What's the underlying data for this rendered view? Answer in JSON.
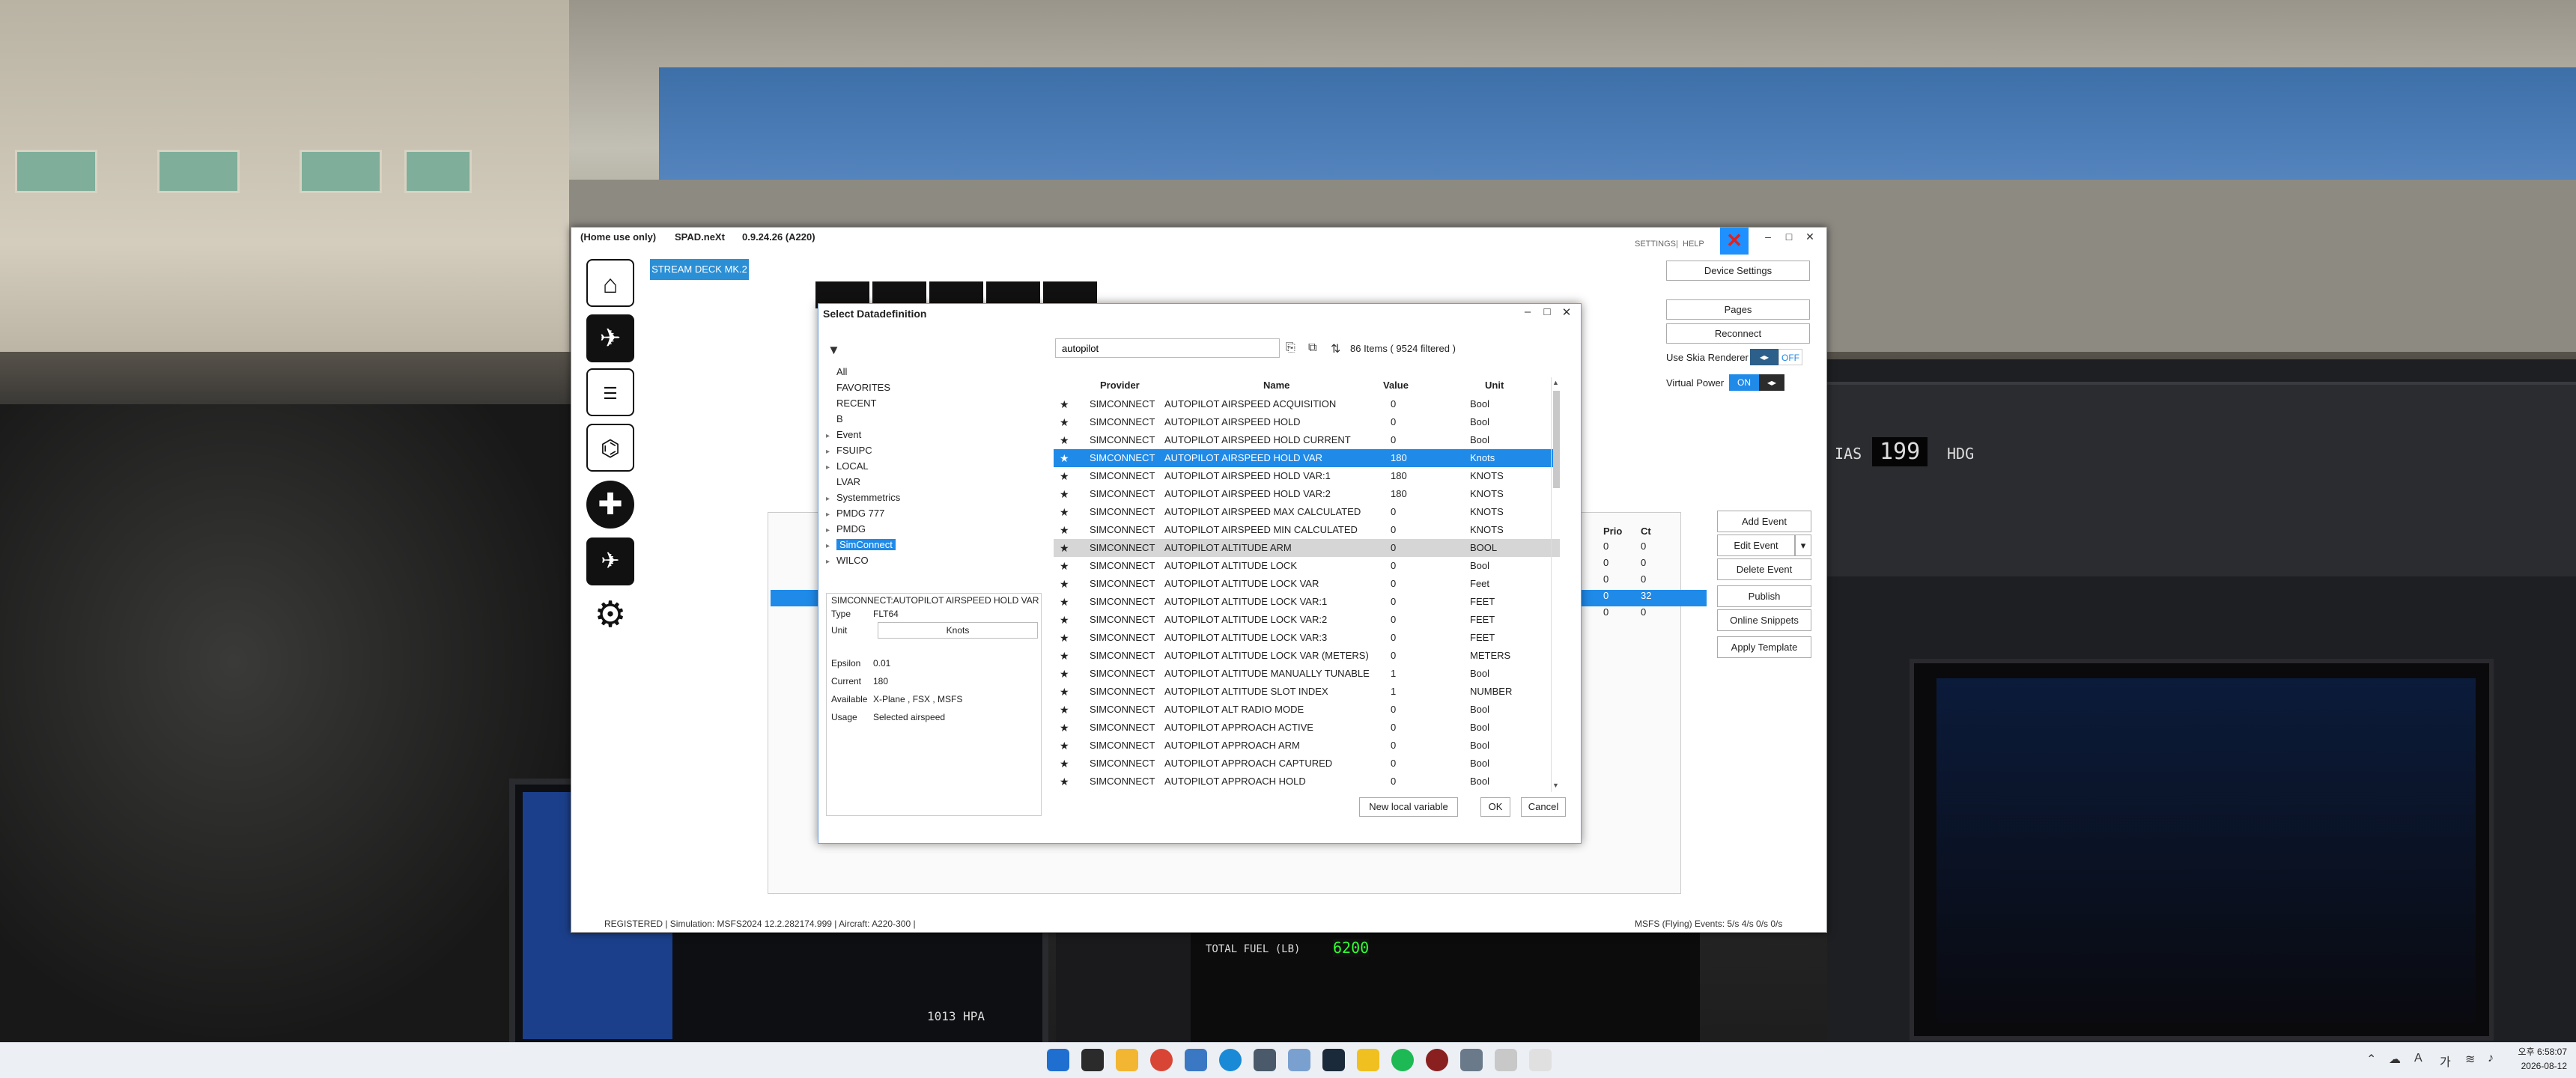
{
  "window": {
    "license": "(Home use only)",
    "app_name": "SPAD.neXt",
    "version": "0.9.24.26 (A220)",
    "settings_label": "SETTINGS",
    "help_label": "HELP",
    "separator": "|",
    "device_tab": "STREAM DECK MK.2"
  },
  "nav_icons": [
    "home-icon",
    "airplane-panel-icon",
    "radio-stack-icon",
    "cockpit-controls-icon",
    "medical-cross-icon",
    "camera-plane-icon",
    "settings-gears-icon"
  ],
  "right_panel": {
    "device_settings": "Device Settings",
    "pages": "Pages",
    "reconnect": "Reconnect",
    "skia_label": "Use Skia Renderer",
    "skia_toggle": "OFF",
    "power_label": "Virtual Power",
    "power_toggle": "ON",
    "toggle_knob": "◂▸"
  },
  "side_buttons": {
    "add_event": "Add Event",
    "edit_event": "Edit Event",
    "delete_event": "Delete Event",
    "publish": "Publish",
    "online_snippets": "Online Snippets",
    "apply_template": "Apply Template"
  },
  "background_table": {
    "prio_header": "Prio",
    "ct_header": "Ct",
    "rows": [
      {
        "prio": "0",
        "ct": "0"
      },
      {
        "prio": "0",
        "ct": "0"
      },
      {
        "prio": "0",
        "ct": "0"
      },
      {
        "prio": "0",
        "ct": "32"
      },
      {
        "prio": "0",
        "ct": "0"
      }
    ]
  },
  "status_bar": {
    "left": "REGISTERED  | Simulation: MSFS2024 12.2.282174.999  | Aircraft: A220-300  |",
    "right": "MSFS (Flying)  Events: 5/s 4/s 0/s 0/s"
  },
  "dialog": {
    "title": "Select Datadefinition",
    "search_value": "autopilot",
    "count_text": "86 Items ( 9524 filtered )",
    "tree": [
      {
        "label": "All",
        "arrow": false
      },
      {
        "label": "FAVORITES",
        "arrow": false
      },
      {
        "label": "RECENT",
        "arrow": false
      },
      {
        "label": "B",
        "arrow": false
      },
      {
        "label": "Event",
        "arrow": true
      },
      {
        "label": "FSUIPC",
        "arrow": true
      },
      {
        "label": "LOCAL",
        "arrow": true
      },
      {
        "label": "LVAR",
        "arrow": false
      },
      {
        "label": "Systemmetrics",
        "arrow": true
      },
      {
        "label": "PMDG 777",
        "arrow": true
      },
      {
        "label": "PMDG",
        "arrow": true
      },
      {
        "label": "SimConnect",
        "arrow": true,
        "selected": true
      },
      {
        "label": "WILCO",
        "arrow": true
      }
    ],
    "info": {
      "title": "SIMCONNECT:AUTOPILOT AIRSPEED HOLD VAR",
      "type_label": "Type",
      "type_value": "FLT64",
      "unit_label": "Unit",
      "unit_value": "Knots",
      "epsilon_label": "Epsilon",
      "epsilon_value": "0.01",
      "current_label": "Current",
      "current_value": "180",
      "available_label": "Available",
      "available_value": "X-Plane , FSX , MSFS",
      "usage_label": "Usage",
      "usage_value": "Selected airspeed"
    },
    "columns": {
      "provider": "Provider",
      "name": "Name",
      "value": "Value",
      "unit": "Unit"
    },
    "rows": [
      {
        "provider": "SIMCONNECT",
        "name": "AUTOPILOT AIRSPEED ACQUISITION",
        "value": "0",
        "unit": "Bool"
      },
      {
        "provider": "SIMCONNECT",
        "name": "AUTOPILOT AIRSPEED HOLD",
        "value": "0",
        "unit": "Bool"
      },
      {
        "provider": "SIMCONNECT",
        "name": "AUTOPILOT AIRSPEED HOLD CURRENT",
        "value": "0",
        "unit": "Bool"
      },
      {
        "provider": "SIMCONNECT",
        "name": "AUTOPILOT AIRSPEED HOLD VAR",
        "value": "180",
        "unit": "Knots",
        "state": "selected"
      },
      {
        "provider": "SIMCONNECT",
        "name": "AUTOPILOT AIRSPEED HOLD VAR:1",
        "value": "180",
        "unit": "KNOTS"
      },
      {
        "provider": "SIMCONNECT",
        "name": "AUTOPILOT AIRSPEED HOLD VAR:2",
        "value": "180",
        "unit": "KNOTS"
      },
      {
        "provider": "SIMCONNECT",
        "name": "AUTOPILOT AIRSPEED MAX CALCULATED",
        "value": "0",
        "unit": "KNOTS"
      },
      {
        "provider": "SIMCONNECT",
        "name": "AUTOPILOT AIRSPEED MIN CALCULATED",
        "value": "0",
        "unit": "KNOTS"
      },
      {
        "provider": "SIMCONNECT",
        "name": "AUTOPILOT ALTITUDE ARM",
        "value": "0",
        "unit": "BOOL",
        "state": "hover"
      },
      {
        "provider": "SIMCONNECT",
        "name": "AUTOPILOT ALTITUDE LOCK",
        "value": "0",
        "unit": "Bool"
      },
      {
        "provider": "SIMCONNECT",
        "name": "AUTOPILOT ALTITUDE LOCK VAR",
        "value": "0",
        "unit": "Feet"
      },
      {
        "provider": "SIMCONNECT",
        "name": "AUTOPILOT ALTITUDE LOCK VAR:1",
        "value": "0",
        "unit": "FEET"
      },
      {
        "provider": "SIMCONNECT",
        "name": "AUTOPILOT ALTITUDE LOCK VAR:2",
        "value": "0",
        "unit": "FEET"
      },
      {
        "provider": "SIMCONNECT",
        "name": "AUTOPILOT ALTITUDE LOCK VAR:3",
        "value": "0",
        "unit": "FEET"
      },
      {
        "provider": "SIMCONNECT",
        "name": "AUTOPILOT ALTITUDE LOCK VAR (METERS)",
        "value": "0",
        "unit": "METERS"
      },
      {
        "provider": "SIMCONNECT",
        "name": "AUTOPILOT ALTITUDE MANUALLY TUNABLE",
        "value": "1",
        "unit": "Bool"
      },
      {
        "provider": "SIMCONNECT",
        "name": "AUTOPILOT ALTITUDE SLOT INDEX",
        "value": "1",
        "unit": "NUMBER"
      },
      {
        "provider": "SIMCONNECT",
        "name": "AUTOPILOT ALT RADIO MODE",
        "value": "0",
        "unit": "Bool"
      },
      {
        "provider": "SIMCONNECT",
        "name": "AUTOPILOT APPROACH ACTIVE",
        "value": "0",
        "unit": "Bool"
      },
      {
        "provider": "SIMCONNECT",
        "name": "AUTOPILOT APPROACH ARM",
        "value": "0",
        "unit": "Bool"
      },
      {
        "provider": "SIMCONNECT",
        "name": "AUTOPILOT APPROACH CAPTURED",
        "value": "0",
        "unit": "Bool"
      },
      {
        "provider": "SIMCONNECT",
        "name": "AUTOPILOT APPROACH HOLD",
        "value": "0",
        "unit": "Bool"
      }
    ],
    "new_local_variable": "New local variable",
    "ok": "OK",
    "cancel": "Cancel"
  },
  "cockpit": {
    "ias_label": "IAS",
    "ias_value": "199",
    "hdg_label": "HDG",
    "qnh": "1013 HPA",
    "fuel_label": "TOTAL FUEL (LB)",
    "fuel_value": "6200"
  },
  "taskbar": {
    "time": "오후 6:58:07",
    "date": "2026-08-12",
    "lang": "A",
    "ime": "가"
  }
}
